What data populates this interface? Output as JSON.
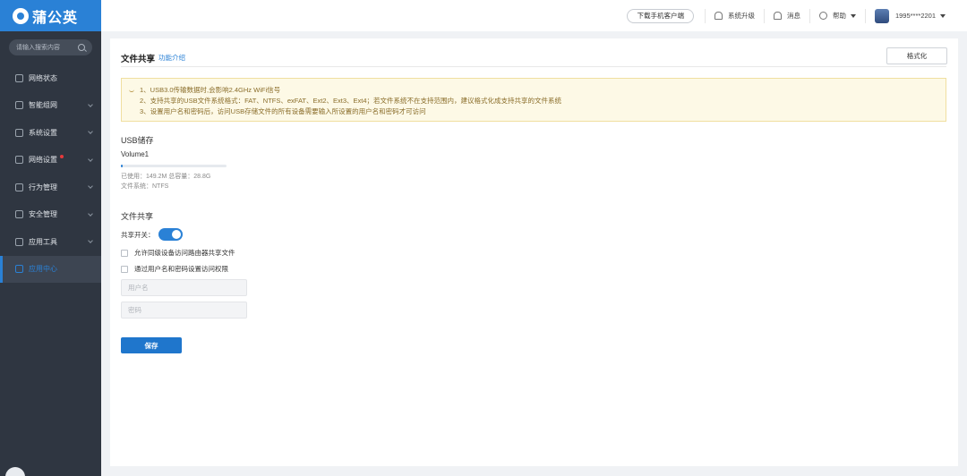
{
  "brand": {
    "name": "蒲公英"
  },
  "sidebar": {
    "search_placeholder": "请输入搜索内容",
    "items": [
      {
        "label": "网络状态",
        "has_chevron": false
      },
      {
        "label": "智能组网",
        "has_chevron": true
      },
      {
        "label": "系统设置",
        "has_chevron": true
      },
      {
        "label": "网络设置",
        "has_chevron": true,
        "badge": true
      },
      {
        "label": "行为管理",
        "has_chevron": true
      },
      {
        "label": "安全管理",
        "has_chevron": true
      },
      {
        "label": "应用工具",
        "has_chevron": true
      },
      {
        "label": "应用中心",
        "has_chevron": false,
        "active": true
      }
    ]
  },
  "topbar": {
    "download_client": "下载手机客户端",
    "upgrade": "系统升级",
    "messages": "消息",
    "help": "帮助",
    "user": "1995****2201"
  },
  "page": {
    "title": "文件共享",
    "intro_link": "功能介绍",
    "format_button": "格式化",
    "notice": [
      "1、USB3.0传输数据时,会影响2.4GHz WiFi信号",
      "2、支持共享的USB文件系统格式：FAT、NTFS、exFAT、Ext2、Ext3、Ext4；若文件系统不在支持范围内，建议格式化成支持共享的文件系统",
      "3、设置用户名和密码后，访问USB存储文件的所有设备需要输入所设置的用户名和密码才可访问"
    ],
    "usb": {
      "section_title": "USB储存",
      "volume_name": "Volume1",
      "used_fraction": 0.005,
      "usage_text": "已使用：149.2M   总容量：28.8G",
      "fs_text": "文件系统：NTFS"
    },
    "share": {
      "section_title": "文件共享",
      "toggle_label": "共享开关：",
      "toggle_on": true,
      "option_lan": "允许同级设备访问路由器共享文件",
      "option_auth": "通过用户名和密码设置访问权限",
      "username_placeholder": "用户名",
      "password_placeholder": "密码"
    },
    "save_button": "保存"
  },
  "colors": {
    "accent": "#2a81d6",
    "sidebar": "#2f3641",
    "notice_bg": "#fdf9e6"
  }
}
